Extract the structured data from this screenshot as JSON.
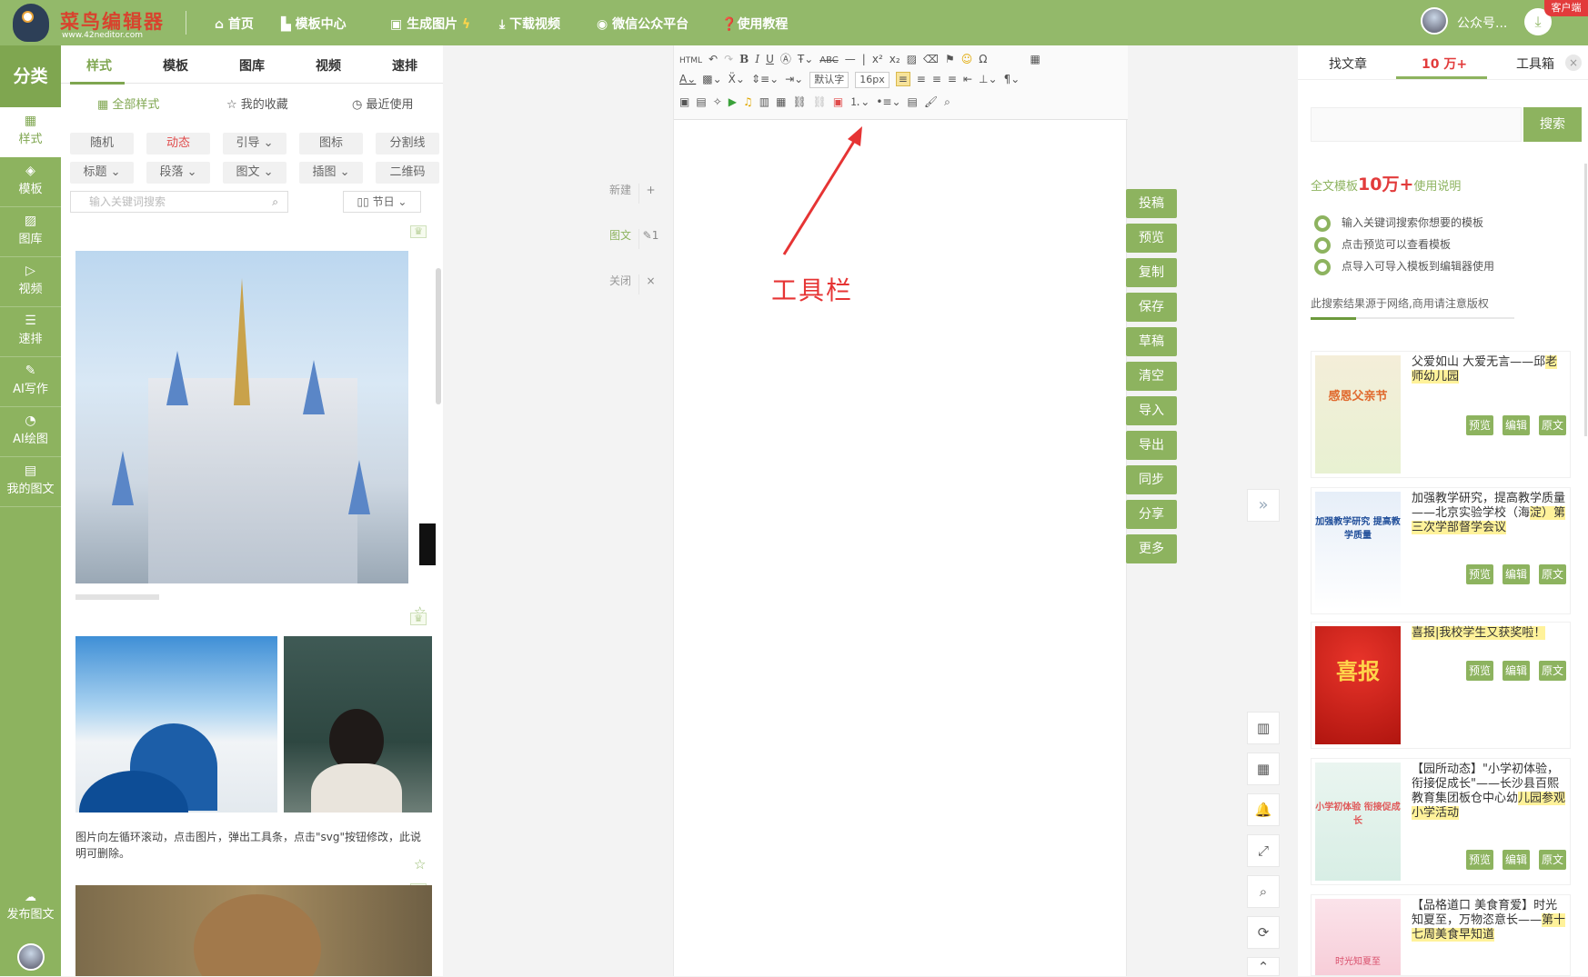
{
  "app": {
    "name": "菜鸟编辑器",
    "url": "www.42neditor.com",
    "client_badge": "客户端",
    "colors": {
      "brand": "#93b96a",
      "accent_red": "#e23b3b",
      "highlight": "#fff29a"
    }
  },
  "top_nav": [
    {
      "icon": "home-icon",
      "label": "首页"
    },
    {
      "icon": "template-icon",
      "label": "模板中心"
    },
    {
      "icon": "image-icon",
      "label": "生成图片"
    },
    {
      "icon": "download-icon",
      "label": "下载视频"
    },
    {
      "icon": "wechat-icon",
      "label": "微信公众平台"
    },
    {
      "icon": "help-icon",
      "label": "使用教程"
    }
  ],
  "user": {
    "label": "公众号..."
  },
  "left_nav": {
    "header": "分类",
    "items": [
      {
        "icon": "style-icon",
        "label": "样式",
        "active": true
      },
      {
        "icon": "layers-icon",
        "label": "模板"
      },
      {
        "icon": "picture-icon",
        "label": "图库"
      },
      {
        "icon": "video-icon",
        "label": "视频"
      },
      {
        "icon": "sliders-icon",
        "label": "速排"
      },
      {
        "icon": "pen-icon",
        "label": "AI写作"
      },
      {
        "icon": "palette-icon",
        "label": "AI绘图"
      },
      {
        "icon": "doc-icon",
        "label": "我的图文"
      }
    ],
    "publish": "发布图文"
  },
  "style_panel": {
    "tabs": [
      "样式",
      "模板",
      "图库",
      "视频",
      "速排"
    ],
    "subtabs": [
      "全部样式",
      "我的收藏",
      "最近使用"
    ],
    "chips_row1": [
      "随机",
      "动态",
      "引导",
      "图标",
      "分割线"
    ],
    "chips_row2": [
      "标题",
      "段落",
      "图文",
      "插图",
      "二维码"
    ],
    "search_placeholder": "输入关键词搜索",
    "holiday_filter": "节日",
    "caption": "图片向左循环滚动，点击图片，弹出工具条，点击\"svg\"按钮修改，此说明可删除。"
  },
  "middle_tools": [
    {
      "label": "新建",
      "icon": "plus-icon"
    },
    {
      "label": "图文",
      "icon": "edit-icon",
      "count": "1"
    },
    {
      "label": "关闭",
      "icon": "close-icon"
    }
  ],
  "editor": {
    "font_name": "默认字",
    "font_size": "16px",
    "annotation": "工具栏",
    "html_btn": "HTML"
  },
  "actions": [
    "投稿",
    "预览",
    "复制",
    "保存",
    "草稿",
    "清空",
    "导入",
    "导出",
    "同步",
    "分享",
    "更多"
  ],
  "right_panel": {
    "tabs": [
      "找文章",
      "10 万+",
      "工具箱"
    ],
    "search_button": "搜索",
    "info_prefix": "全文模板",
    "info_big": "10万+",
    "info_suffix": "使用说明",
    "steps": [
      "输入关键词搜索你想要的模板",
      "点击预览可以查看模板",
      "点导入可导入模板到编辑器使用"
    ],
    "note": "此搜索结果源于网络,商用请注意版权",
    "card_buttons": [
      "预览",
      "编辑",
      "原文"
    ],
    "cards": [
      {
        "title_plain": "父爱如山 大爱无言——邱",
        "title_hl": "老师幼儿园",
        "thumb_text": "感恩父亲节"
      },
      {
        "title_plain": "加强教学研究，提高教学质量——北京实验学校（海",
        "title_hl": "淀）第三次学部督学会议",
        "thumb_text": "加强教学研究 提高教学质量"
      },
      {
        "title_plain": "",
        "title_hl": "喜报|我校学生又获奖啦！",
        "thumb_text": "喜报"
      },
      {
        "title_plain": "【园所动态】\"小学初体验，衔接促成长\"——长沙县百熙教育集团板仓中心幼",
        "title_hl": "儿园参观小学活动",
        "thumb_text": "小学初体验 衔接促成长"
      },
      {
        "title_plain": "【品格道口 美食育爱】时光知夏至，万物恣意长——",
        "title_hl": "第十七周美食早知道",
        "thumb_text": "时光知夏至"
      }
    ]
  }
}
